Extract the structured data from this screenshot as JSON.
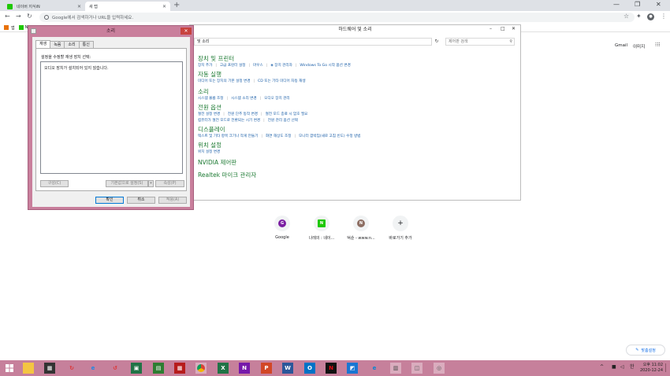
{
  "browser": {
    "tabs": [
      {
        "title": "네이버 지식iN",
        "icon": "naver-icon"
      },
      {
        "title": "새 탭",
        "icon": "new-tab-icon"
      }
    ],
    "omnibox_placeholder": "Google에서 검색하거나 URL을 입력하세요.",
    "bookmarks": [
      {
        "label": "앱",
        "icon": "apps-grid-icon"
      },
      {
        "label": "N",
        "icon": "naver-icon"
      }
    ]
  },
  "ntp": {
    "gmail": "Gmail",
    "images": "이미지",
    "shortcuts": [
      {
        "label": "Google",
        "letter": "G",
        "color": "#7b1fa2"
      },
      {
        "label": "나레의 : 네이...",
        "letter": "N",
        "color": "#1ec800"
      },
      {
        "label": "덕순 - www.n...",
        "letter": "N",
        "color": "#8d6e63"
      },
      {
        "label": "바로가기 추가",
        "letter": "+",
        "color": "#f1f3f4"
      }
    ],
    "customize": "맞춤설정"
  },
  "control_panel": {
    "title": "하드웨어 및 소리",
    "address": "및 소리",
    "search_placeholder": "제어판 검색",
    "sections": [
      {
        "title": "장치 및 프린터",
        "links": [
          "장치 추가",
          "고급 프린터 설정",
          "마우스",
          "장치 관리자",
          "Windows To Go 시작 옵션 변경"
        ]
      },
      {
        "title": "자동 실행",
        "links": [
          "미디어 또는 장치의 기본 설정 변경",
          "CD 또는 기타 미디어 자동 재생"
        ]
      },
      {
        "title": "소리",
        "links": [
          "시스템 볼륨 조정",
          "시스템 소리 변경",
          "오디오 장치 관리"
        ]
      },
      {
        "title": "전원 옵션",
        "links": [
          "절전 설정 변경",
          "전원 단추 동작 변경",
          "절전 모드 종료 시 암호 필요",
          "컴퓨터가 절전 모드로 전환되는 시기 변경",
          "전원 관리 옵션 선택"
        ]
      },
      {
        "title": "디스플레이",
        "links": [
          "텍스트 및 기타 항목 크기나 작게 만들기",
          "화면 해상도 조정",
          "모니터 깜박임(새로 고침 빈도) 수정 방법"
        ]
      },
      {
        "title": "위치 설정",
        "links": [
          "위치 설정 변경"
        ]
      },
      {
        "title": "NVIDIA 제어판",
        "links": []
      },
      {
        "title": "Realtek 마이크 관리자",
        "links": []
      }
    ]
  },
  "sound_dialog": {
    "title": "소리",
    "tabs": [
      "재생",
      "녹음",
      "소리",
      "통신"
    ],
    "instruction": "설정을 수정할 재생 장치 선택:",
    "empty_message": "오디오 장치가 설치되어 있지 않습니다.",
    "configure": "구성(C)",
    "set_default": "기본값으로 설정(S)",
    "properties": "속성(P)",
    "ok": "확인",
    "cancel": "취소",
    "apply": "적용(A)"
  },
  "tray": {
    "ime": "한",
    "time": "오후 11:02",
    "date": "2020-12-24"
  }
}
